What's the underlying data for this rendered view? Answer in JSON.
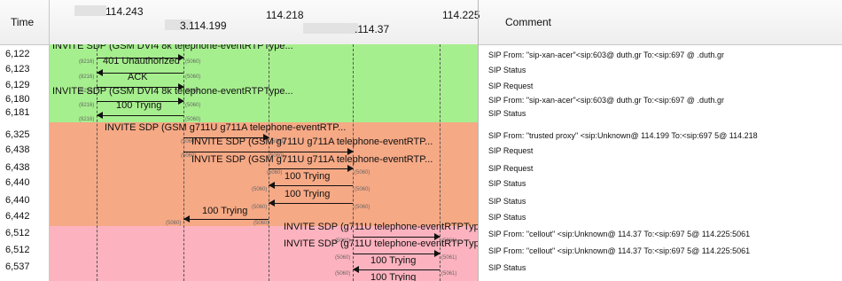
{
  "header": {
    "time_label": "Time",
    "comment_label": "Comment",
    "hosts": [
      "114.243",
      "3.114.199",
      "114.218",
      ".114.37",
      "114.225"
    ]
  },
  "colors": {
    "green": "#a6ef8e",
    "orange": "#f6a985",
    "pink": "#fcb3bf"
  },
  "rows": [
    {
      "time": "6,122",
      "comment": "SIP From: \"sip-xan-acer\"<sip:603@          duth.gr To:<sip:697           @       .duth.gr"
    },
    {
      "time": "6,123",
      "comment": "SIP Status"
    },
    {
      "time": "6,129",
      "comment": "SIP Request"
    },
    {
      "time": "6,180",
      "comment": "SIP From: \"sip-xan-acer\"<sip:603@          duth.gr To:<sip:697           @       .duth.gr"
    },
    {
      "time": "6,181",
      "comment": "SIP Status"
    },
    {
      "time": "6,325",
      "comment": "SIP From: \"trusted proxy\" <sip:Unknown@          114.199 To:<sip:697          5@          114.218"
    },
    {
      "time": "6,438",
      "comment": "SIP Request"
    },
    {
      "time": "6,438",
      "comment": "SIP Request"
    },
    {
      "time": "6,440",
      "comment": "SIP Status"
    },
    {
      "time": "6,440",
      "comment": "SIP Status"
    },
    {
      "time": "6,442",
      "comment": "SIP Status"
    },
    {
      "time": "6,512",
      "comment": "SIP From: \"cellout\" <sip:Unknown@          114.37 To:<sip:697          5@          114.225:5061"
    },
    {
      "time": "6,512",
      "comment": "SIP From: \"cellout\" <sip:Unknown@          114.37 To:<sip:697          5@          114.225:5061"
    },
    {
      "time": "6,537",
      "comment": "SIP Status"
    }
  ],
  "messages": [
    {
      "label": "INVITE SDP (GSM DVI4 8k telephone-eventRTPType...",
      "p1": "(8216)",
      "p2": "(5060)"
    },
    {
      "label": "401 Unauthorized",
      "p1": "(8216)",
      "p2": "(5060)"
    },
    {
      "label": "ACK",
      "p1": "(8216)",
      "p2": "(5060)"
    },
    {
      "label": "INVITE SDP (GSM DVI4 8k telephone-eventRTPType...",
      "p1": "(8216)",
      "p2": "(5060)"
    },
    {
      "label": "100 Trying",
      "p1": "(8216)",
      "p2": "(5060)"
    },
    {
      "label": "INVITE SDP (GSM g711U g711A telephone-eventRTP...",
      "p1": "(5060)",
      "p2": "(5061)"
    },
    {
      "label": "INVITE SDP (GSM g711U g711A telephone-eventRTP...",
      "p1": "(5060)",
      "p2": "(5060)"
    },
    {
      "label": "INVITE SDP (GSM g711U g711A telephone-eventRTP...",
      "p1": "(5060)",
      "p2": "(5060)"
    },
    {
      "label": "100 Trying",
      "p1": "(5060)",
      "p2": "(5060)"
    },
    {
      "label": "100 Trying",
      "p1": "(5060)",
      "p2": "(5060)"
    },
    {
      "label": "100 Trying",
      "p1": "(5060)",
      "p2": "(5060)"
    },
    {
      "label": "INVITE SDP (g711U telephone-eventRTPTyp",
      "p1": "(5060)",
      "p2": "(5061)"
    },
    {
      "label": "INVITE SDP (g711U telephone-eventRTPTyp",
      "p1": "(5060)",
      "p2": "(5061)"
    },
    {
      "label": "100 Trying",
      "p1": "(5060)",
      "p2": "(5061)"
    },
    {
      "label": "100 Trying"
    }
  ]
}
